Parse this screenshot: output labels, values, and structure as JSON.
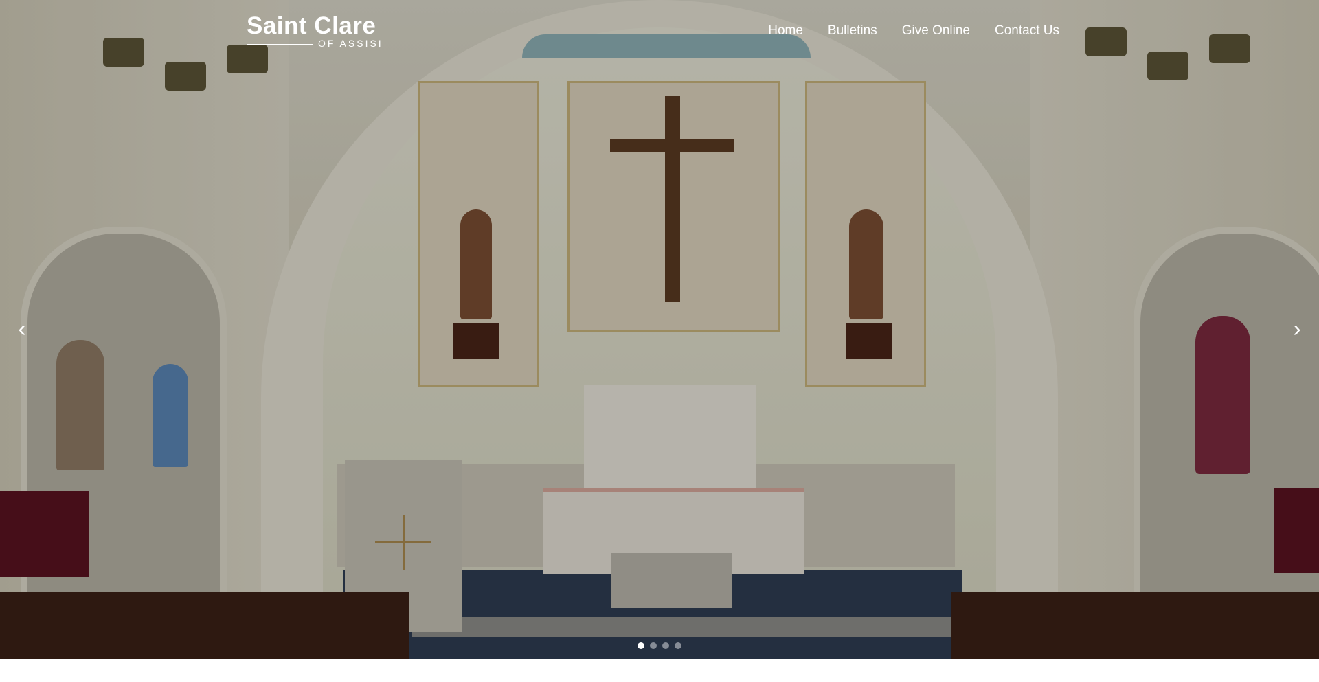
{
  "header": {
    "logo": {
      "title": "Saint Clare",
      "subtitle": "OF ASSISI"
    },
    "nav": [
      {
        "label": "Home"
      },
      {
        "label": "Bulletins"
      },
      {
        "label": "Give Online"
      },
      {
        "label": "Contact Us"
      }
    ]
  },
  "carousel": {
    "prev_icon": "chevron-left-icon",
    "next_icon": "chevron-right-icon",
    "prev_glyph": "‹",
    "next_glyph": "›",
    "slide_count": 4,
    "active_slide": 1
  },
  "colors": {
    "text": "#ffffff",
    "pew": "#3b2116",
    "floor": "#2f3d52"
  }
}
